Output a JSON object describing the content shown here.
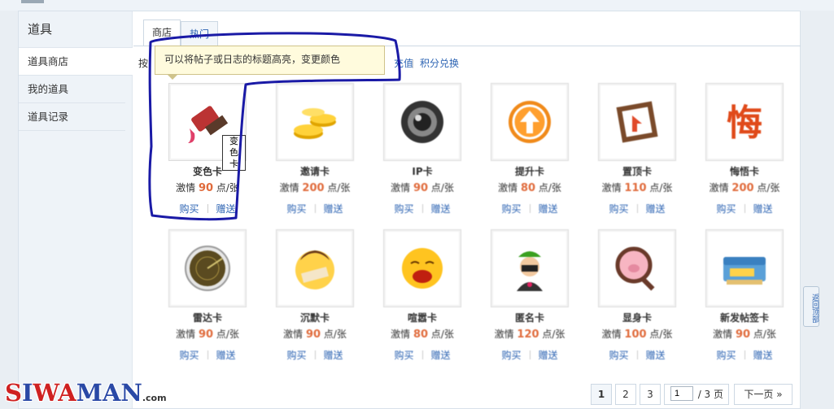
{
  "sidebar": {
    "title": "道具",
    "items": [
      {
        "label": "道具商店"
      },
      {
        "label": "我的道具"
      },
      {
        "label": "道具记录"
      }
    ]
  },
  "tabs": [
    {
      "label": "商店"
    },
    {
      "label": "热门"
    }
  ],
  "filter": {
    "prefix": "按",
    "link_a": "充值",
    "link_b": "积分兑换"
  },
  "tooltip": {
    "text": "可以将帖子或日志的标题高亮，变更颜色"
  },
  "currency": "激情",
  "unit": "点/张",
  "actions": {
    "buy": "购买",
    "gift": "赠送"
  },
  "hover_label": "变色卡",
  "items": [
    {
      "name": "变色卡",
      "price": "90",
      "icon": "paint-brush-icon"
    },
    {
      "name": "邀请卡",
      "price": "200",
      "icon": "gold-coins-icon"
    },
    {
      "name": "IP卡",
      "price": "90",
      "icon": "camera-lens-icon"
    },
    {
      "name": "提升卡",
      "price": "80",
      "icon": "up-arrow-icon"
    },
    {
      "name": "置顶卡",
      "price": "110",
      "icon": "pin-top-icon"
    },
    {
      "name": "悔悟卡",
      "price": "200",
      "icon": "regret-char-icon"
    },
    {
      "name": "雷达卡",
      "price": "90",
      "icon": "radar-icon"
    },
    {
      "name": "沉默卡",
      "price": "90",
      "icon": "gagged-face-icon"
    },
    {
      "name": "喧嚣卡",
      "price": "80",
      "icon": "shouting-face-icon"
    },
    {
      "name": "匿名卡",
      "price": "120",
      "icon": "masked-person-icon"
    },
    {
      "name": "显身卡",
      "price": "100",
      "icon": "magnifier-pig-icon"
    },
    {
      "name": "新发帖签卡",
      "price": "90",
      "icon": "card-icon"
    }
  ],
  "pager": {
    "pages": [
      "1",
      "2",
      "3"
    ],
    "current": "1",
    "input_value": "1",
    "total": "/ 3 页",
    "next": "下一页 »"
  },
  "sidetool": "返回顶部",
  "watermark": {
    "red1": "S",
    "blue1": "I",
    "red2": "WA",
    "blue2": "MAN",
    "dot": ".com"
  },
  "colors": {
    "accent_link": "#2d64b3",
    "price": "#e06b3c",
    "annotation": "#1a1aa6",
    "watermark_red": "#cf2121",
    "watermark_blue": "#2a49a6"
  }
}
